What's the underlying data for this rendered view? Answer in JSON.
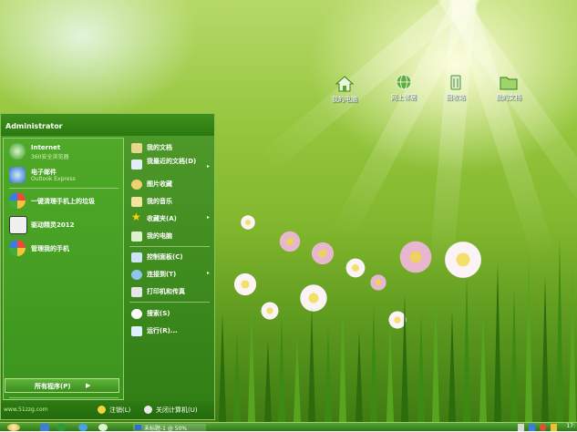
{
  "desktop": {
    "icons": [
      {
        "label": "我的电脑",
        "icon": "computer-icon"
      },
      {
        "label": "网上邻居",
        "icon": "network-icon"
      },
      {
        "label": "回收站",
        "icon": "recycle-bin-icon"
      },
      {
        "label": "我的文档",
        "icon": "folder-icon"
      }
    ]
  },
  "start_menu": {
    "user": "Administrator",
    "pinned": [
      {
        "title": "Internet",
        "subtitle": "360安全浏览器",
        "icon": "browser-icon"
      },
      {
        "title": "电子邮件",
        "subtitle": "Outlook Express",
        "icon": "email-icon"
      }
    ],
    "recent": [
      {
        "title": "一键清理手机上的垃圾",
        "icon": "cleaner-icon"
      },
      {
        "title": "驱动精灵2012",
        "icon": "driver-icon"
      },
      {
        "title": "管理我的手机",
        "icon": "phone-manager-icon"
      }
    ],
    "all_programs": "所有程序(P)",
    "right": [
      {
        "label": "我的文档",
        "icon": "documents-icon",
        "arrow": ""
      },
      {
        "label": "我最近的文档(D)",
        "icon": "recent-docs-icon",
        "arrow": "▸"
      },
      {
        "label": "图片收藏",
        "icon": "pictures-icon",
        "arrow": ""
      },
      {
        "label": "我的音乐",
        "icon": "music-icon",
        "arrow": ""
      },
      {
        "label": "收藏夹(A)",
        "icon": "favorites-icon",
        "arrow": "▸"
      },
      {
        "label": "我的电脑",
        "icon": "my-computer-icon",
        "arrow": ""
      },
      {
        "label": "控制面板(C)",
        "icon": "control-panel-icon",
        "arrow": ""
      },
      {
        "label": "连接到(T)",
        "icon": "connect-icon",
        "arrow": "▸"
      },
      {
        "label": "打印机和传真",
        "icon": "printer-icon",
        "arrow": ""
      },
      {
        "label": "搜索(S)",
        "icon": "search-icon",
        "arrow": ""
      },
      {
        "label": "运行(R)...",
        "icon": "run-icon",
        "arrow": ""
      }
    ],
    "footer": {
      "site": "www.51zzg.com",
      "logoff": "注销(L)",
      "shutdown": "关闭计算机(U)"
    }
  },
  "taskbar": {
    "task": "未标题-1 @ 50%",
    "clock": "17:"
  },
  "colors": {
    "menu_green": "#2f7d14",
    "accent_light": "#8cc25a",
    "panel_green": "#4f9a2a"
  }
}
